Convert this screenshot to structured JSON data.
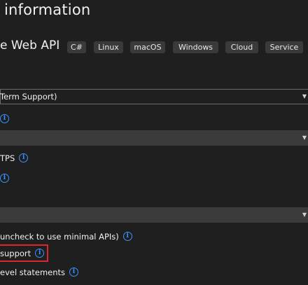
{
  "header": {
    "title": "information"
  },
  "template": {
    "name": "e Web API",
    "tags": [
      "C#",
      "Linux",
      "macOS",
      "Windows",
      "Cloud",
      "Service"
    ]
  },
  "framework": {
    "value": "Term Support)"
  },
  "https": {
    "label": "TPS"
  },
  "options": {
    "controllers_label": "uncheck to use minimal APIs)",
    "openapi_label": "support",
    "toplevel_label": "evel statements"
  },
  "icons": {
    "info": "info-icon",
    "dropdown": "dropdown-arrow-icon"
  },
  "colors": {
    "background": "#1f1f1f",
    "info_icon": "#3794ff",
    "highlight_border": "#e0262b",
    "tag_background": "#3a3a3a"
  }
}
